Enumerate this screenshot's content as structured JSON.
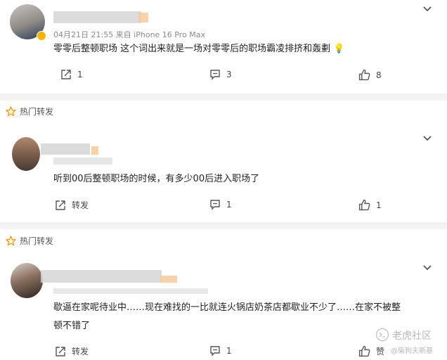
{
  "post1": {
    "meta": "04月21日 21:55  来自 iPhone 16 Pro Max",
    "text": "零零后整顿职场 这个词出来就是一场对零零后的职场霸凌排挤和轰劃 💡",
    "repost_count": "1",
    "comment_count": "3",
    "like_count": "8"
  },
  "section2": {
    "label": "热门转发"
  },
  "post2": {
    "text": "听到00后整顿职场的时候，有多少00后进入职场了",
    "repost_label": "转发",
    "comment_count": "1",
    "like_count": "1"
  },
  "section3": {
    "label": "热门转发"
  },
  "post3": {
    "text_line1": "歇逼在家呢待业中……现在难找的一比就连火锅店奶茶店都歇业不少了……在家不被整",
    "text_line2": "顿不错了",
    "repost_label": "转发",
    "comment_count": "1",
    "like_label": "赞"
  },
  "watermark": {
    "logo_text": "老虎社区",
    "author": "@柴狗夫斯基"
  },
  "colors": {
    "star": "#f0a020",
    "divider": "#f2f2f2",
    "text": "#222222",
    "meta": "#8a8a8a"
  }
}
